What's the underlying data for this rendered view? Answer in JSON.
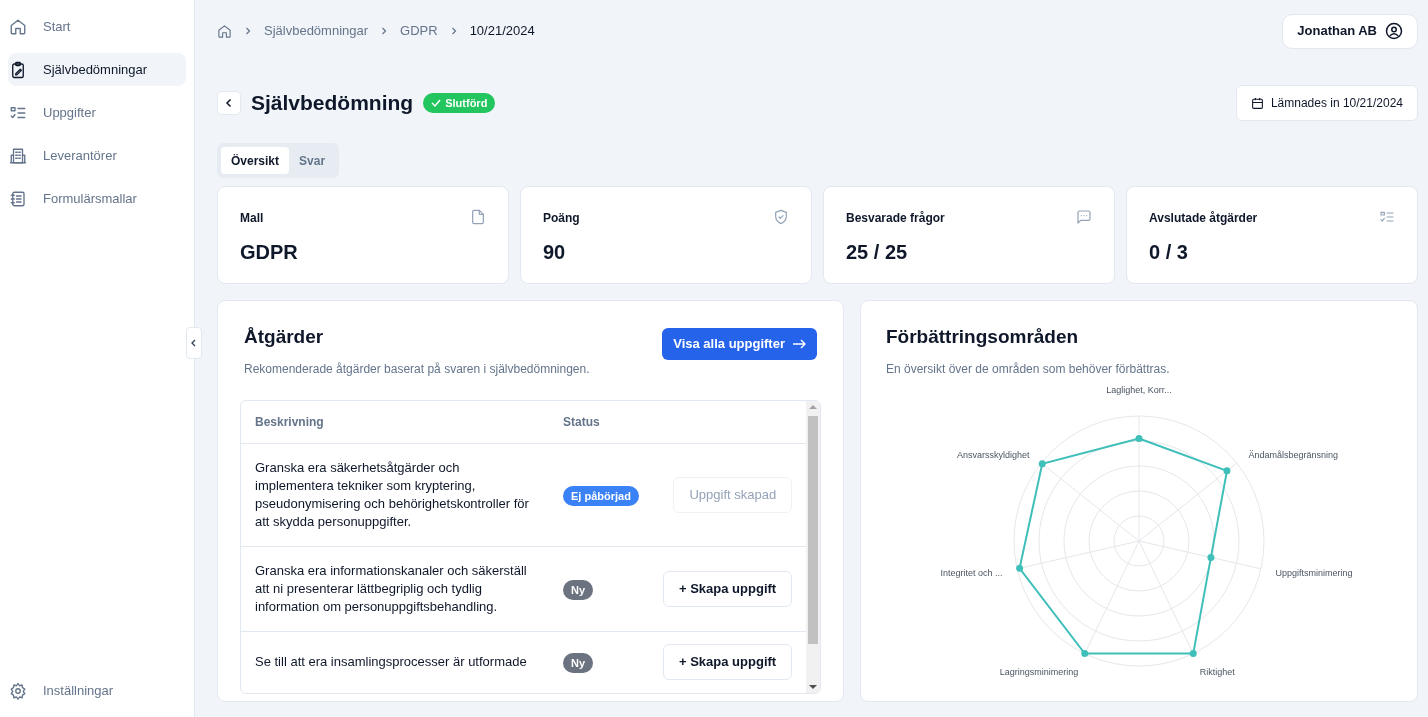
{
  "sidebar": {
    "items": [
      {
        "label": "Start",
        "selected": false
      },
      {
        "label": "Självbedömningar",
        "selected": true
      },
      {
        "label": "Uppgifter",
        "selected": false
      },
      {
        "label": "Leverantörer",
        "selected": false
      },
      {
        "label": "Formulärsmallar",
        "selected": false
      }
    ],
    "footer": {
      "label": "Inställningar"
    }
  },
  "breadcrumbs": [
    "Självbedömningar",
    "GDPR",
    "10/21/2024"
  ],
  "user_button": "Jonathan AB",
  "page": {
    "title": "Självbedömning",
    "status": "Slutförd",
    "submitted": "Lämnades in 10/21/2024"
  },
  "tabs": [
    {
      "label": "Översikt",
      "selected": true
    },
    {
      "label": "Svar",
      "selected": false
    }
  ],
  "stats": [
    {
      "label": "Mall",
      "value": "GDPR"
    },
    {
      "label": "Poäng",
      "value": "90"
    },
    {
      "label": "Besvarade frågor",
      "value": "25 / 25"
    },
    {
      "label": "Avslutade åtgärder",
      "value": "0 / 3"
    }
  ],
  "actions": {
    "title": "Åtgärder",
    "subtitle": "Rekomenderade åtgärder baserat på svaren i självbedömningen.",
    "button": "Visa alla uppgifter",
    "columns": [
      "Beskrivning",
      "Status"
    ],
    "rows": [
      {
        "description": "Granska era säkerhetsåtgärder och implementera tekniker som kryptering, pseudonymisering och behörighetskontroller för att skydda personuppgifter.",
        "status": "Ej påbörjad",
        "kind": "started",
        "action": "Uppgift skapad",
        "disabled": true
      },
      {
        "description": "Granska era informationskanaler och säkerställ att ni presenterar lättbegriplig och tydlig information om personuppgiftsbehandling.",
        "status": "Ny",
        "kind": "new",
        "action": "+ Skapa uppgift",
        "disabled": false
      },
      {
        "description": "Se till att era insamlingsprocesser är utformade",
        "status": "Ny",
        "kind": "new",
        "action": "+ Skapa uppgift",
        "disabled": false
      }
    ]
  },
  "improvements": {
    "title": "Förbättringsområden",
    "subtitle": "En översikt över de områden som behöver förbättras.",
    "radar_labels": [
      "Laglighet, Korr...",
      "Ansvarsskyldighet",
      "Ändamålsbegränsning",
      "Integritet och ...",
      "Uppgiftsminimering",
      "Lagringsminimering",
      "Riktighet"
    ]
  }
}
